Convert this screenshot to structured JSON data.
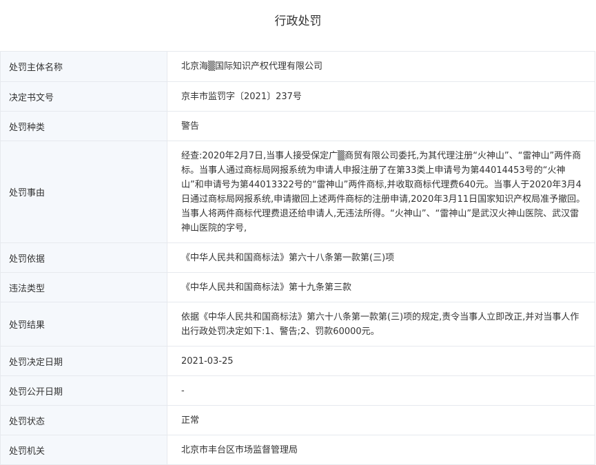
{
  "title": "行政处罚",
  "rows": [
    {
      "label": "处罚主体名称",
      "value": "北京海▒国际知识产权代理有限公司"
    },
    {
      "label": "决定书文号",
      "value": "京丰市监罚字〔2021〕237号"
    },
    {
      "label": "处罚种类",
      "value": "警告"
    },
    {
      "label": "处罚事由",
      "value": "经查:2020年2月7日,当事人接受保定广▒商贸有限公司委托,为其代理注册“火神山”、“雷神山”两件商标。当事人通过商标局网报系统为申请人申报注册了在第33类上申请号为第44014453号的“火神山”和申请号为第44013322号的“雷神山”两件商标,并收取商标代理费640元。当事人于2020年3月4日通过商标局网报系统,申请撤回上述两件商标的注册申请,2020年3月11日国家知识产权局准予撤回。当事人将两件商标代理费退还给申请人,无违法所得。“火神山”、“雷神山”是武汉火神山医院、武汉雷神山医院的字号,"
    },
    {
      "label": "处罚依据",
      "value": "《中华人民共和国商标法》第六十八条第一款第(三)项"
    },
    {
      "label": "违法类型",
      "value": "《中华人民共和国商标法》第十九条第三款"
    },
    {
      "label": "处罚结果",
      "value": "依据《中华人民共和国商标法》第六十八条第一款第(三)项的规定,责令当事人立即改正,并对当事人作出行政处罚决定如下:1、警告;2、罚款60000元。"
    },
    {
      "label": "处罚决定日期",
      "value": "2021-03-25"
    },
    {
      "label": "处罚公开日期",
      "value": "-"
    },
    {
      "label": "处罚状态",
      "value": "正常"
    },
    {
      "label": "处罚机关",
      "value": "北京市丰台区市场监督管理局"
    }
  ]
}
